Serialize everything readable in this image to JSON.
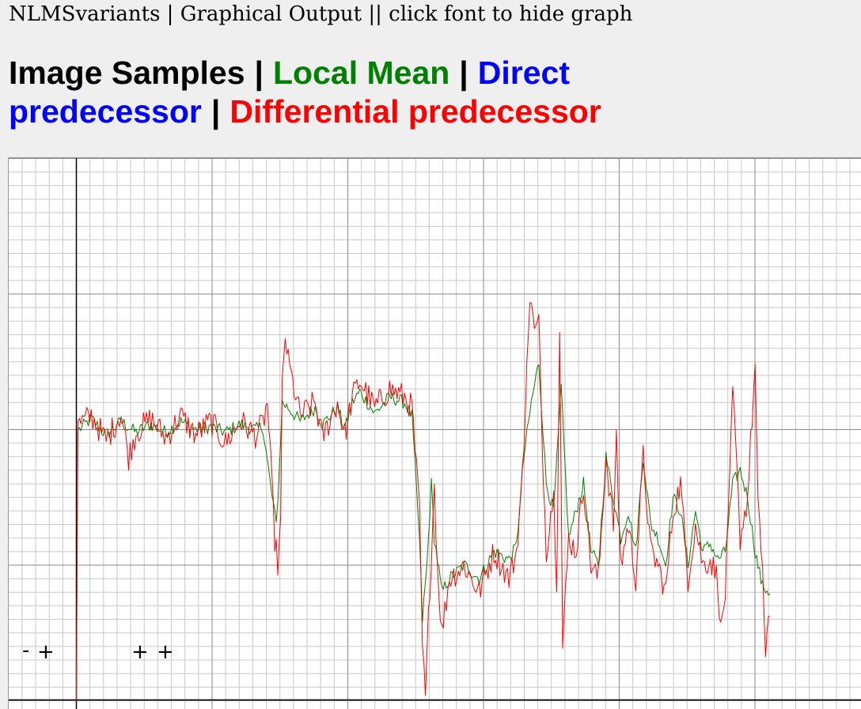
{
  "header": {
    "text": "NLMSvariants | Graphical Output || click font to hide graph"
  },
  "legend": {
    "items": [
      {
        "label": "Image Samples",
        "color": "#000000"
      },
      {
        "label": "Local Mean",
        "color": "#008000"
      },
      {
        "label": "Direct predecessor",
        "color": "#0000ff"
      },
      {
        "label": "Differential predecessor",
        "color": "#ff0000"
      }
    ],
    "separator": "|"
  },
  "controls": {
    "zoom_out": "-",
    "zoom_in": "+",
    "x_zoom_in_1": "+",
    "x_zoom_in_2": "+"
  },
  "chart_data": {
    "type": "line",
    "grid": true,
    "series": [
      {
        "name": "Local Mean",
        "color": "#008000",
        "anchors": [
          [
            0,
            -100
          ],
          [
            1,
            0
          ],
          [
            2,
            0
          ],
          [
            10,
            4
          ],
          [
            20,
            -2
          ],
          [
            30,
            3
          ],
          [
            40,
            -1
          ],
          [
            50,
            2
          ],
          [
            60,
            -1
          ],
          [
            70,
            3
          ],
          [
            80,
            0
          ],
          [
            90,
            1
          ],
          [
            100,
            -1
          ],
          [
            110,
            2
          ],
          [
            120,
            0
          ],
          [
            125,
            1
          ],
          [
            130,
            -20
          ],
          [
            134,
            -35
          ],
          [
            136,
            -15
          ],
          [
            138,
            10
          ],
          [
            142,
            8
          ],
          [
            150,
            3
          ],
          [
            160,
            8
          ],
          [
            165,
            2
          ],
          [
            175,
            8
          ],
          [
            180,
            0
          ],
          [
            185,
            10
          ],
          [
            190,
            14
          ],
          [
            200,
            6
          ],
          [
            210,
            12
          ],
          [
            220,
            10
          ],
          [
            225,
            5
          ],
          [
            230,
            -40
          ],
          [
            232,
            -70
          ],
          [
            235,
            -50
          ],
          [
            238,
            -20
          ],
          [
            240,
            -40
          ],
          [
            245,
            -60
          ],
          [
            250,
            -55
          ],
          [
            260,
            -50
          ],
          [
            270,
            -55
          ],
          [
            280,
            -45
          ],
          [
            290,
            -48
          ],
          [
            295,
            -43
          ],
          [
            300,
            -10
          ],
          [
            305,
            10
          ],
          [
            310,
            25
          ],
          [
            315,
            -20
          ],
          [
            320,
            -30
          ],
          [
            325,
            15
          ],
          [
            330,
            -40
          ],
          [
            335,
            -30
          ],
          [
            340,
            -20
          ],
          [
            345,
            -45
          ],
          [
            350,
            -50
          ],
          [
            355,
            -10
          ],
          [
            360,
            -25
          ],
          [
            365,
            -40
          ],
          [
            370,
            -30
          ],
          [
            375,
            -45
          ],
          [
            380,
            -10
          ],
          [
            385,
            -35
          ],
          [
            390,
            -40
          ],
          [
            395,
            -50
          ],
          [
            400,
            -25
          ],
          [
            405,
            -30
          ],
          [
            410,
            -50
          ],
          [
            415,
            -30
          ],
          [
            420,
            -45
          ],
          [
            425,
            -42
          ],
          [
            430,
            -48
          ],
          [
            435,
            -45
          ],
          [
            440,
            -20
          ],
          [
            445,
            -15
          ],
          [
            450,
            -25
          ],
          [
            455,
            -45
          ],
          [
            460,
            -58
          ],
          [
            465,
            -60
          ]
        ]
      },
      {
        "name": "Differential predecessor",
        "color": "#ff0000",
        "anchors": [
          [
            0,
            -100
          ],
          [
            1,
            3
          ],
          [
            2,
            2
          ],
          [
            10,
            5
          ],
          [
            20,
            -4
          ],
          [
            30,
            6
          ],
          [
            35,
            -10
          ],
          [
            40,
            -1
          ],
          [
            50,
            4
          ],
          [
            60,
            -3
          ],
          [
            70,
            5
          ],
          [
            80,
            -2
          ],
          [
            90,
            3
          ],
          [
            100,
            -5
          ],
          [
            110,
            3
          ],
          [
            120,
            -2
          ],
          [
            125,
            2
          ],
          [
            128,
            10
          ],
          [
            130,
            -10
          ],
          [
            133,
            -40
          ],
          [
            135,
            -50
          ],
          [
            137,
            -35
          ],
          [
            138,
            15
          ],
          [
            140,
            35
          ],
          [
            142,
            25
          ],
          [
            150,
            5
          ],
          [
            160,
            10
          ],
          [
            165,
            -3
          ],
          [
            175,
            10
          ],
          [
            180,
            -2
          ],
          [
            185,
            12
          ],
          [
            190,
            18
          ],
          [
            200,
            8
          ],
          [
            210,
            15
          ],
          [
            220,
            12
          ],
          [
            225,
            8
          ],
          [
            230,
            -30
          ],
          [
            232,
            -80
          ],
          [
            234,
            -100
          ],
          [
            236,
            -70
          ],
          [
            240,
            -20
          ],
          [
            242,
            -50
          ],
          [
            245,
            -75
          ],
          [
            250,
            -55
          ],
          [
            260,
            -50
          ],
          [
            270,
            -60
          ],
          [
            280,
            -45
          ],
          [
            290,
            -55
          ],
          [
            295,
            -45
          ],
          [
            300,
            -10
          ],
          [
            302,
            30
          ],
          [
            305,
            50
          ],
          [
            307,
            35
          ],
          [
            310,
            40
          ],
          [
            312,
            0
          ],
          [
            315,
            -45
          ],
          [
            318,
            -30
          ],
          [
            320,
            -25
          ],
          [
            322,
            -55
          ],
          [
            324,
            40
          ],
          [
            326,
            -80
          ],
          [
            330,
            -40
          ],
          [
            335,
            -45
          ],
          [
            340,
            -20
          ],
          [
            345,
            -50
          ],
          [
            350,
            -55
          ],
          [
            355,
            -10
          ],
          [
            360,
            -35
          ],
          [
            362,
            -5
          ],
          [
            365,
            -50
          ],
          [
            370,
            -35
          ],
          [
            375,
            -55
          ],
          [
            380,
            -10
          ],
          [
            385,
            -45
          ],
          [
            390,
            -50
          ],
          [
            395,
            -60
          ],
          [
            400,
            -30
          ],
          [
            405,
            -20
          ],
          [
            410,
            -55
          ],
          [
            415,
            -35
          ],
          [
            420,
            -50
          ],
          [
            425,
            -48
          ],
          [
            430,
            -55
          ],
          [
            432,
            -75
          ],
          [
            435,
            -60
          ],
          [
            438,
            -20
          ],
          [
            440,
            15
          ],
          [
            445,
            -40
          ],
          [
            450,
            -25
          ],
          [
            452,
            -5
          ],
          [
            455,
            23
          ],
          [
            457,
            -30
          ],
          [
            460,
            -50
          ],
          [
            462,
            -85
          ],
          [
            463,
            -75
          ],
          [
            465,
            -72
          ]
        ]
      }
    ]
  }
}
